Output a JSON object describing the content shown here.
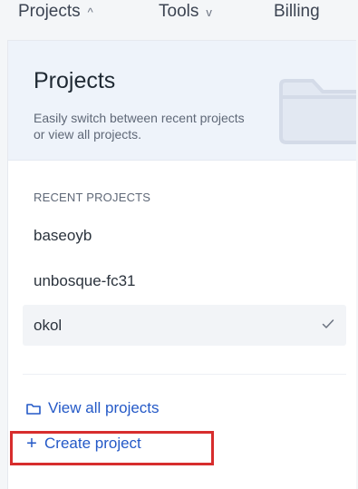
{
  "top_nav": {
    "items": [
      {
        "label": "Projects",
        "chevron": "^"
      },
      {
        "label": "Tools",
        "chevron": "v"
      },
      {
        "label": "Billing",
        "chevron": ""
      }
    ]
  },
  "projects_menu": {
    "title": "Projects",
    "description": "Easily switch between recent projects or view all projects.",
    "recent_label": "RECENT PROJECTS",
    "recent_projects": [
      {
        "name": "baseoyb",
        "selected": false
      },
      {
        "name": "unbosque-fc31",
        "selected": false
      },
      {
        "name": "okol",
        "selected": true
      }
    ],
    "view_all_label": "View all projects",
    "create_project_label": "Create project",
    "create_icon": "+"
  },
  "colors": {
    "link": "#2459c7",
    "header_background": "#eef3fa",
    "highlight_border": "#d72d2d"
  },
  "icons": {
    "folder_illustration": "folder-illustration",
    "selected": "check-icon",
    "view_all": "folder-icon",
    "create": "plus-icon"
  }
}
